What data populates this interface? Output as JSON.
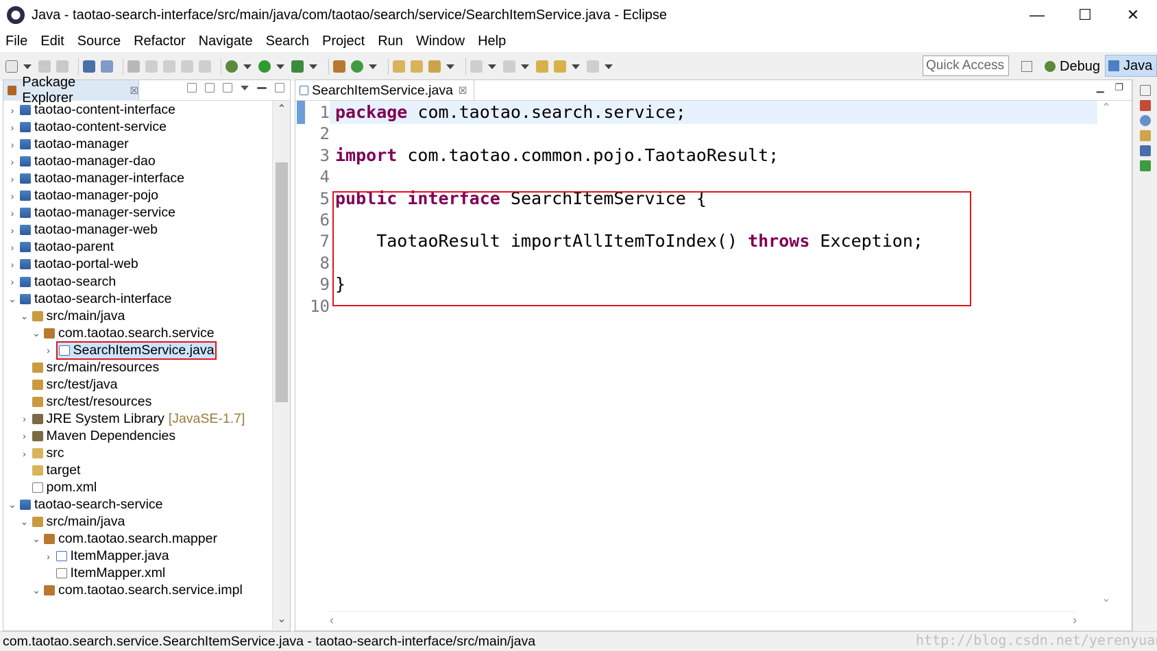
{
  "window": {
    "title": "Java - taotao-search-interface/src/main/java/com/taotao/search/service/SearchItemService.java - Eclipse",
    "minimize": "—",
    "maximize": "☐",
    "close": "✕"
  },
  "menu": [
    "File",
    "Edit",
    "Source",
    "Refactor",
    "Navigate",
    "Search",
    "Project",
    "Run",
    "Window",
    "Help"
  ],
  "toolbar": {
    "quick_access": "Quick Access",
    "perspectives": {
      "debug": "Debug",
      "java": "Java"
    }
  },
  "package_explorer": {
    "title": "Package Explorer",
    "close": "☒",
    "tree": [
      {
        "label": "taotao-content-interface",
        "indent": 0,
        "expanded": false,
        "icon": "project-icon"
      },
      {
        "label": "taotao-content-service",
        "indent": 0,
        "expanded": false,
        "icon": "project-icon"
      },
      {
        "label": "taotao-manager",
        "indent": 0,
        "expanded": false,
        "icon": "project-icon"
      },
      {
        "label": "taotao-manager-dao",
        "indent": 0,
        "expanded": false,
        "icon": "project-icon"
      },
      {
        "label": "taotao-manager-interface",
        "indent": 0,
        "expanded": false,
        "icon": "project-icon"
      },
      {
        "label": "taotao-manager-pojo",
        "indent": 0,
        "expanded": false,
        "icon": "project-icon"
      },
      {
        "label": "taotao-manager-service",
        "indent": 0,
        "expanded": false,
        "icon": "project-icon"
      },
      {
        "label": "taotao-manager-web",
        "indent": 0,
        "expanded": false,
        "icon": "project-icon"
      },
      {
        "label": "taotao-parent",
        "indent": 0,
        "expanded": false,
        "icon": "project-icon"
      },
      {
        "label": "taotao-portal-web",
        "indent": 0,
        "expanded": false,
        "icon": "project-icon"
      },
      {
        "label": "taotao-search",
        "indent": 0,
        "expanded": false,
        "icon": "project-icon"
      },
      {
        "label": "taotao-search-interface",
        "indent": 0,
        "expanded": true,
        "icon": "project-icon"
      },
      {
        "label": "src/main/java",
        "indent": 1,
        "expanded": true,
        "icon": "source-folder-icon"
      },
      {
        "label": "com.taotao.search.service",
        "indent": 2,
        "expanded": true,
        "icon": "package-icon"
      },
      {
        "label": "SearchItemService.java",
        "indent": 3,
        "expanded": false,
        "icon": "java-file-icon",
        "selected": true
      },
      {
        "label": "src/main/resources",
        "indent": 1,
        "expanded": null,
        "icon": "source-folder-icon"
      },
      {
        "label": "src/test/java",
        "indent": 1,
        "expanded": null,
        "icon": "source-folder-icon"
      },
      {
        "label": "src/test/resources",
        "indent": 1,
        "expanded": null,
        "icon": "source-folder-icon"
      },
      {
        "label": "JRE System Library",
        "suffix": "[JavaSE-1.7]",
        "indent": 1,
        "expanded": false,
        "icon": "library-icon"
      },
      {
        "label": "Maven Dependencies",
        "indent": 1,
        "expanded": false,
        "icon": "library-icon"
      },
      {
        "label": "src",
        "indent": 1,
        "expanded": false,
        "icon": "folder-icon"
      },
      {
        "label": "target",
        "indent": 1,
        "expanded": null,
        "icon": "folder-icon"
      },
      {
        "label": "pom.xml",
        "indent": 1,
        "expanded": null,
        "icon": "xml-file-icon"
      },
      {
        "label": "taotao-search-service",
        "indent": 0,
        "expanded": true,
        "icon": "project-icon"
      },
      {
        "label": "src/main/java",
        "indent": 1,
        "expanded": true,
        "icon": "source-folder-icon"
      },
      {
        "label": "com.taotao.search.mapper",
        "indent": 2,
        "expanded": true,
        "icon": "package-icon"
      },
      {
        "label": "ItemMapper.java",
        "indent": 3,
        "expanded": false,
        "icon": "java-file-icon"
      },
      {
        "label": "ItemMapper.xml",
        "indent": 3,
        "expanded": null,
        "icon": "xml-file-icon"
      },
      {
        "label": "com.taotao.search.service.impl",
        "indent": 2,
        "expanded": true,
        "icon": "package-icon"
      }
    ]
  },
  "editor": {
    "tab_label": "SearchItemService.java",
    "tab_close": "☒",
    "line_numbers": [
      "1",
      "2",
      "3",
      "4",
      "5",
      "6",
      "7",
      "8",
      "9",
      "10"
    ],
    "lines": [
      [
        {
          "t": "package",
          "kw": true
        },
        {
          "t": " com.taotao.search.service;"
        }
      ],
      [],
      [
        {
          "t": "import",
          "kw": true
        },
        {
          "t": " com.taotao.common.pojo.TaotaoResult;"
        }
      ],
      [],
      [
        {
          "t": "public",
          "kw": true
        },
        {
          "t": " "
        },
        {
          "t": "interface",
          "kw": true
        },
        {
          "t": " SearchItemService {"
        }
      ],
      [],
      [
        {
          "t": "    TaotaoResult importAllItemToIndex() "
        },
        {
          "t": "throws",
          "kw": true
        },
        {
          "t": " Exception;"
        }
      ],
      [],
      [
        {
          "t": "}"
        }
      ],
      []
    ]
  },
  "status": {
    "text": "com.taotao.search.service.SearchItemService.java - taotao-search-interface/src/main/java"
  },
  "watermark": "http://blog.csdn.net/yerenyuan_pku",
  "colors": {
    "keyword": "#7f0055",
    "highlight_border": "#e0141d",
    "current_line": "#e8f2fe",
    "selection": "#cce4fb"
  }
}
